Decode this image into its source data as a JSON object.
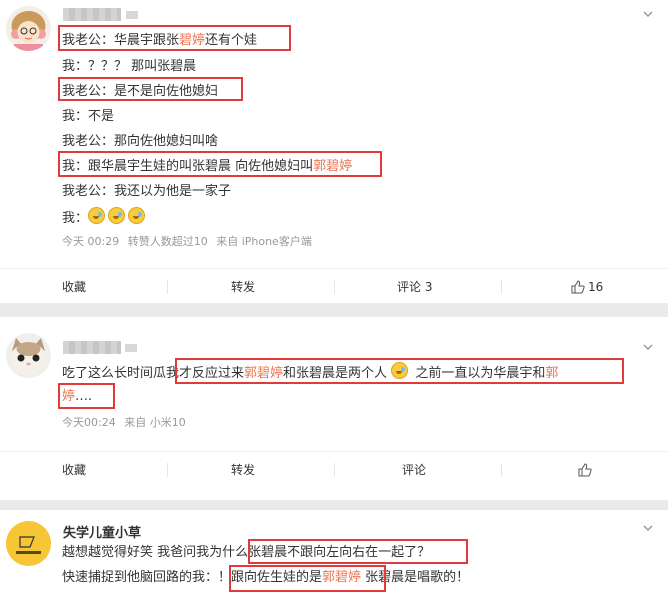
{
  "post1": {
    "lines": [
      {
        "parts": [
          {
            "t": "我老公：华晨宇跟张"
          },
          {
            "t": "碧婷",
            "hl": true
          },
          {
            "t": "还有个娃"
          }
        ]
      },
      {
        "parts": [
          {
            "t": "我：？？？ 那叫张碧晨"
          }
        ]
      },
      {
        "parts": [
          {
            "t": "我老公：是不是向佐他媳妇"
          }
        ]
      },
      {
        "parts": [
          {
            "t": "我：不是"
          }
        ]
      },
      {
        "parts": [
          {
            "t": "我老公：那向佐他媳妇叫啥"
          }
        ]
      },
      {
        "parts": [
          {
            "t": "我：跟华晨宇生娃的叫张碧晨 向佐他媳妇叫"
          },
          {
            "t": "郭碧婷",
            "hl": true
          }
        ]
      },
      {
        "parts": [
          {
            "t": "我老公：我还以为他是一家子"
          }
        ]
      },
      {
        "parts": [
          {
            "t": "我："
          },
          {
            "emoji": "sad-tear-emoji"
          },
          {
            "emoji": "sad-tear-emoji"
          },
          {
            "emoji": "sad-tear-emoji"
          }
        ]
      }
    ],
    "meta": {
      "time": "今天 00:29",
      "likes_info": "转赞人数超过10",
      "source": "来自 iPhone客户端"
    },
    "actions": {
      "collect": "收藏",
      "repost": "转发",
      "comment": "评论 3",
      "like": "16"
    }
  },
  "post2": {
    "line1": [
      {
        "t": "吃了这么长时间瓜"
      },
      {
        "t": "我才反应过来"
      },
      {
        "t": "郭碧婷",
        "hl": true
      },
      {
        "t": "和张碧晨是两个人 "
      },
      {
        "emoji": "sad-tear-emoji"
      },
      {
        "t": " 之前一直以为华晨宇和"
      },
      {
        "t": "郭",
        "hl": true
      }
    ],
    "line2": [
      {
        "t": "婷",
        "hl": true
      },
      {
        "t": "…."
      }
    ],
    "meta": {
      "time": "今天00:24",
      "source": "来自 小米10"
    },
    "actions": {
      "collect": "收藏",
      "repost": "转发",
      "comment": "评论",
      "like": ""
    }
  },
  "post3": {
    "username": "失学儿童小草",
    "line1": [
      {
        "t": "越想越觉得好笑 我爸问我为什么张碧晨不跟向左向右在一起了？"
      }
    ],
    "line2": [
      {
        "t": "快速捕捉到他脑回路的我：！跟向佐生娃的是"
      },
      {
        "t": "郭碧婷",
        "hl": true
      },
      {
        "t": "  张碧晨是唱歌的！"
      }
    ]
  },
  "colors": {
    "highlight": "#eb7350",
    "annotation_box": "#e23a3a",
    "meta_text": "#999999"
  }
}
